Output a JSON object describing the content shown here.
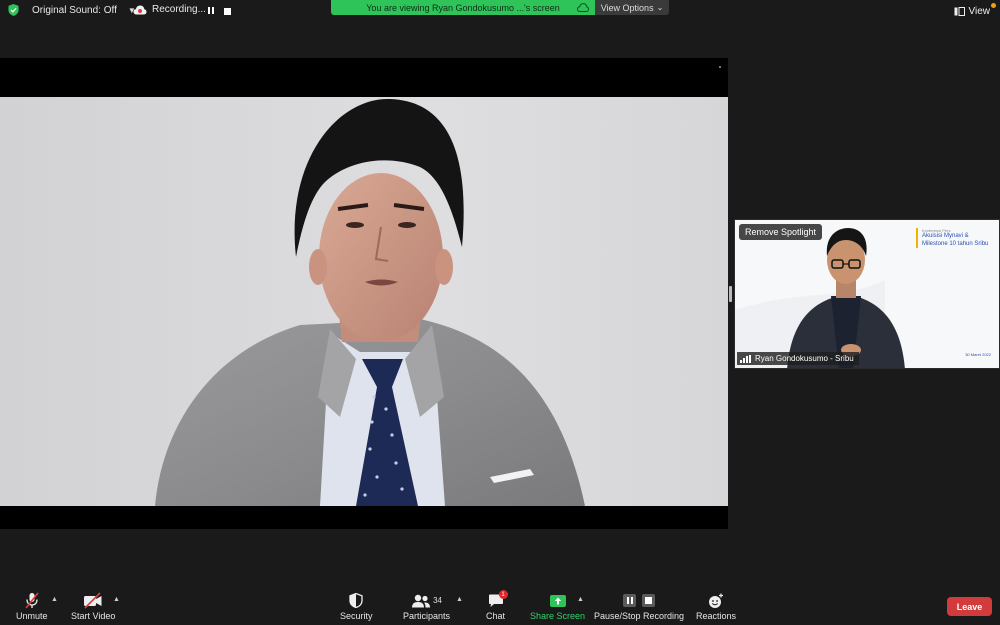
{
  "top_bar": {
    "original_sound": "Original Sound: Off",
    "recording": "Recording...",
    "banner": "You are viewing Ryan Gondokusumo ...'s screen",
    "view_options": "View Options",
    "view": "View"
  },
  "spotlight": {
    "remove_label": "Remove Spotlight",
    "participant_name": "Ryan Gondokusumo - Sribu",
    "slide_line1": "Konferensi Pers",
    "slide_line2": "Akuisisi Mynavi &",
    "slide_line3": "Milestone 10 tahun Sribu",
    "slide_date": "30 Maret 2022"
  },
  "toolbar": {
    "unmute": "Unmute",
    "start_video": "Start Video",
    "security": "Security",
    "participants": "Participants",
    "participants_count": "34",
    "chat": "Chat",
    "chat_badge": "1",
    "share_screen": "Share Screen",
    "pause_stop_recording": "Pause/Stop Recording",
    "reactions": "Reactions",
    "leave": "Leave"
  },
  "colors": {
    "banner_green": "#2fc45a",
    "leave_red": "#d13b3b",
    "background": "#1a1a1a"
  }
}
